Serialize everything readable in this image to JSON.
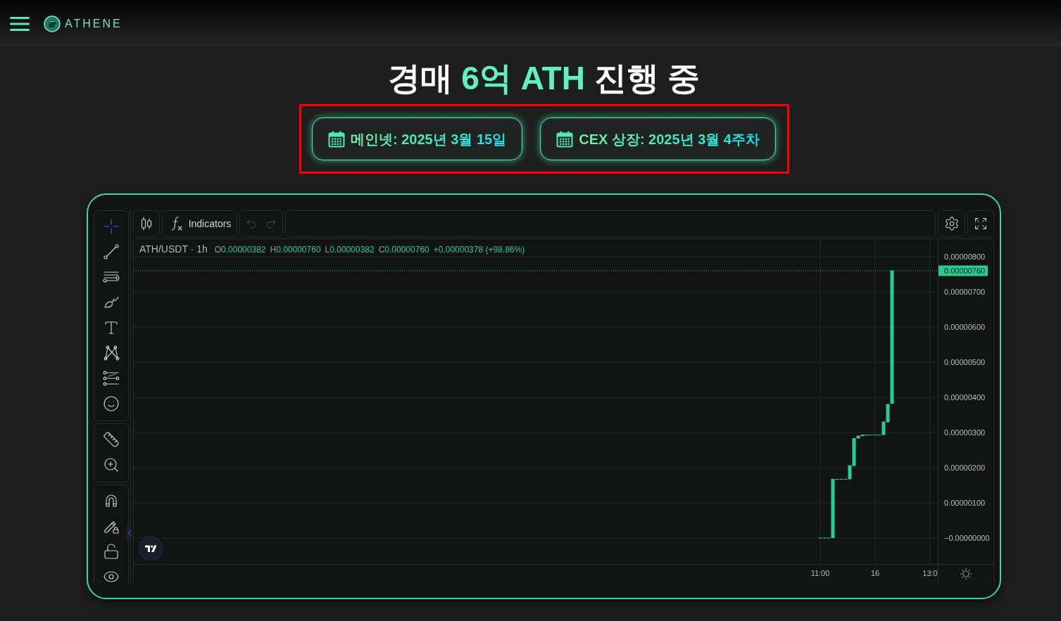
{
  "header": {
    "logo_text": "ATHENE"
  },
  "title": [
    {
      "text": "경매",
      "highlight": false
    },
    {
      "text": "6억 ATH",
      "highlight": true
    },
    {
      "text": "진행 중",
      "highlight": false
    }
  ],
  "schedule": [
    {
      "label": "메인넷: 2025년 3월 15일"
    },
    {
      "label": "CEX 상장: 2025년 3월 4주차"
    }
  ],
  "chart": {
    "tool_groups": [
      {
        "tools": [
          {
            "kind": "crosshair",
            "selected": true
          },
          {
            "kind": "trend-line",
            "selected": false
          },
          {
            "kind": "horizontal-lines",
            "selected": false
          },
          {
            "kind": "brush",
            "selected": false
          },
          {
            "kind": "text",
            "selected": false
          },
          {
            "kind": "pattern",
            "selected": false
          },
          {
            "kind": "forecast",
            "selected": false
          },
          {
            "kind": "emoji",
            "selected": false
          }
        ]
      },
      {
        "tools": [
          {
            "kind": "ruler",
            "selected": false
          },
          {
            "kind": "zoom-in",
            "selected": false
          }
        ]
      },
      {
        "tools": [
          {
            "kind": "magnet",
            "selected": false
          },
          {
            "kind": "pencil-lock",
            "selected": false
          },
          {
            "kind": "lock",
            "selected": false
          },
          {
            "kind": "eye",
            "selected": false
          }
        ]
      }
    ],
    "toolbar": {
      "indicators_label": "Indicators",
      "undo": {
        "disabled": true
      },
      "redo": {
        "disabled": true
      }
    },
    "legend": {
      "symbol": "ATH/USDT · 1h",
      "ohlc": [
        {
          "label": "O",
          "value": "0.00000382"
        },
        {
          "label": "H",
          "value": "0.00000760"
        },
        {
          "label": "L",
          "value": "0.00000382"
        },
        {
          "label": "C",
          "value": "0.00000760"
        }
      ],
      "change": "+0.00000378 (+98.86%)"
    },
    "chart_data": [
      {
        "type": "candlestick",
        "color": "#26cf91",
        "grid": true,
        "categories": [
          "11:00",
          null,
          null,
          null,
          null,
          null,
          null,
          null,
          null,
          null,
          null,
          null,
          null,
          "16",
          null,
          null,
          null,
          null,
          null,
          null,
          null,
          null,
          null,
          null,
          null,
          null,
          "13:0"
        ],
        "ohlc": [
          [
            0,
            0,
            0,
            0
          ],
          [
            0,
            0,
            0,
            0
          ],
          [
            0,
            0,
            0,
            0
          ],
          [
            0,
            1.67e-06,
            0,
            1.67e-06
          ],
          [
            1.67e-06,
            1.67e-06,
            1.67e-06,
            1.67e-06
          ],
          [
            1.67e-06,
            1.67e-06,
            1.67e-06,
            1.67e-06
          ],
          [
            1.67e-06,
            1.67e-06,
            1.67e-06,
            1.67e-06
          ],
          [
            1.67e-06,
            2.06e-06,
            1.67e-06,
            2.06e-06
          ],
          [
            2.05e-06,
            2.83e-06,
            2.05e-06,
            2.83e-06
          ],
          [
            2.83e-06,
            2.9e-06,
            2.83e-06,
            2.9e-06
          ],
          [
            2.9e-06,
            2.93e-06,
            2.9e-06,
            2.93e-06
          ],
          [
            2.93e-06,
            2.93e-06,
            2.93e-06,
            2.93e-06
          ],
          [
            2.93e-06,
            2.93e-06,
            2.93e-06,
            2.93e-06
          ],
          [
            2.93e-06,
            2.93e-06,
            2.93e-06,
            2.93e-06
          ],
          [
            2.93e-06,
            2.93e-06,
            2.93e-06,
            2.93e-06
          ],
          [
            2.93e-06,
            3.3e-06,
            2.93e-06,
            3.3e-06
          ],
          [
            3.29e-06,
            3.8e-06,
            3.29e-06,
            3.8e-06
          ],
          [
            3.82e-06,
            7.6e-06,
            3.82e-06,
            7.6e-06
          ],
          null,
          null,
          null,
          null,
          null,
          null,
          null,
          null,
          null
        ],
        "ylim": [
          -7.4e-07,
          8.5e-06
        ],
        "yticks": [
          {
            "value": 0,
            "label": "−0.00000000"
          },
          {
            "value": 1e-06,
            "label": "0.00000100"
          },
          {
            "value": 2e-06,
            "label": "0.00000200"
          },
          {
            "value": 3e-06,
            "label": "0.00000300"
          },
          {
            "value": 4e-06,
            "label": "0.00000400"
          },
          {
            "value": 5e-06,
            "label": "0.00000500"
          },
          {
            "value": 6e-06,
            "label": "0.00000600"
          },
          {
            "value": 7e-06,
            "label": "0.00000700"
          },
          {
            "value": 8e-06,
            "label": "0.00000800"
          }
        ],
        "ref_lines": [
          {
            "axis": "y",
            "value": 7.6e-06,
            "label": "0.00000760",
            "color": "#26cf91",
            "line_style": "dotted"
          }
        ]
      }
    ]
  }
}
